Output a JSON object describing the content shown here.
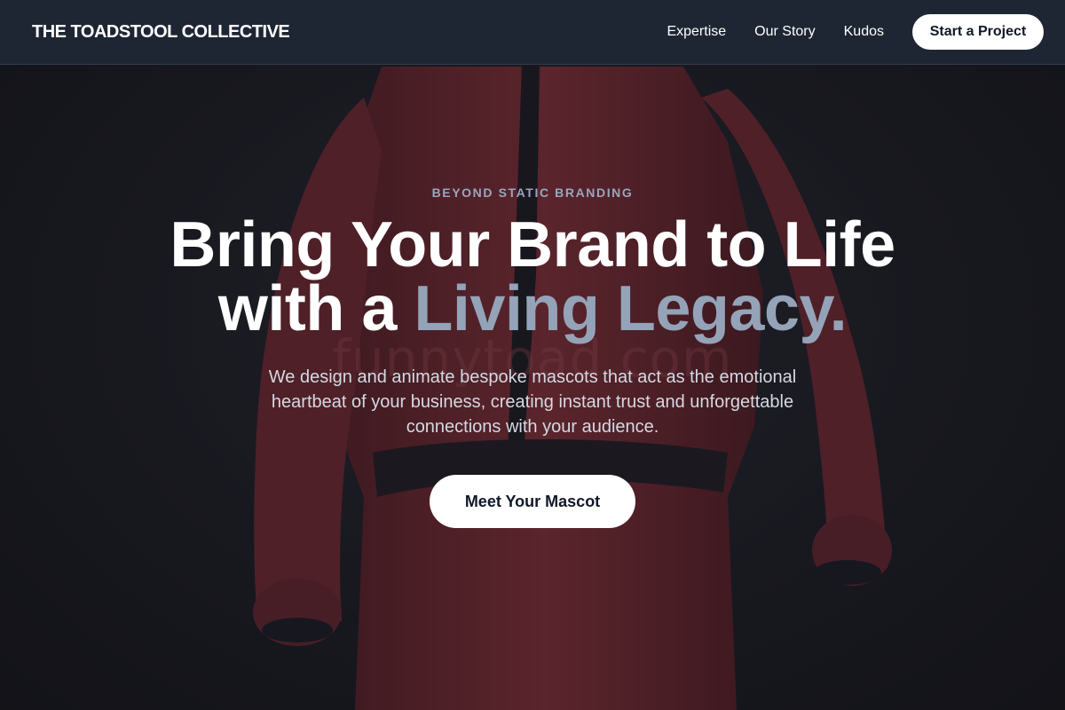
{
  "nav": {
    "brand": "THE TOADSTOOL COLLECTIVE",
    "links": [
      "Expertise",
      "Our Story",
      "Kudos"
    ],
    "cta_label": "Start a Project"
  },
  "hero": {
    "eyebrow": "BEYOND STATIC BRANDING",
    "headline_line1": "Bring Your Brand to Life",
    "headline_line2_prefix": "with a ",
    "headline_line2_accent": "Living Legacy.",
    "subtext": "We design and animate bespoke mascots that act as the emotional heartbeat of your business, creating instant trust and unforgettable connections with your audience.",
    "cta_label": "Meet Your Mascot",
    "watermark": "funnytoad.com"
  },
  "colors": {
    "navbar_bg": "#1e2633",
    "accent_text": "#94a3b8",
    "button_bg": "#ffffff",
    "button_text": "#111827",
    "mascot_suit": "#8a2f35"
  }
}
